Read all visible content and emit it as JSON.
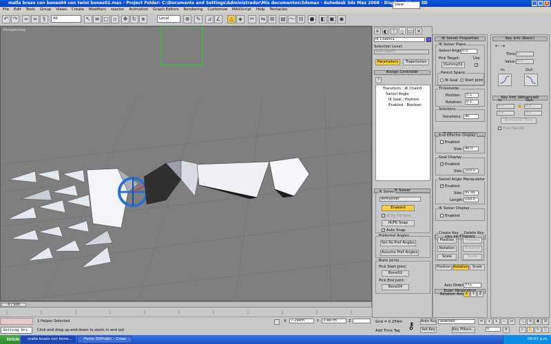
{
  "window": {
    "title": "malla brazo con bones04 con twist bones02.max   - Project Folder: C:\\Documents and Settings\\Administrador\\Mis documentos\\3dsmax   - Autodesk 3ds Max 2008   - Display : Direct 3D"
  },
  "menu": [
    "File",
    "Edit",
    "Tools",
    "Group",
    "Views",
    "Create",
    "Modifiers",
    "reactor",
    "Animation",
    "Graph Editors",
    "Rendering",
    "Customize",
    "MAXScript",
    "Help",
    "Tentacles"
  ],
  "toolbar": {
    "filter_value": "All",
    "coord_value": "Local",
    "view_value": "View"
  },
  "viewport": {
    "label": "Perspective",
    "frame_counter": "0 / 100"
  },
  "command_panel": {
    "object_name": "IK Chain01",
    "selection_level_label": "Selection Level:",
    "sub_object_value": "Sub-Object",
    "parameters_tab": "Parameters",
    "trajectories_tab": "Trajectories",
    "assign_controller_title": "Assign Controller",
    "controller_tree": [
      "Transform : IK Chain0",
      "Swivel Angle",
      "IK Goal : Position",
      "Enabled : Boolean"
    ],
    "ik_solver_title": "IK Solver",
    "solver_value": "IKHISolver",
    "enabled_button": "Enabled",
    "ik_for_fk_pose": "IK for FK Pose",
    "ikfk_snap_button": "IK/FK Snap",
    "auto_snap_label": "Auto Snap",
    "preferred_angles_title": "Preferred Angles",
    "set_pref_angles_button": "Set As Pref Angles",
    "assume_pref_angles_button": "Assume Pref Angles",
    "bone_joints_title": "Bone Joints",
    "pick_start_joint_label": "Pick Start Joint:",
    "start_joint_button": "Bone02",
    "pick_end_joint_label": "Pick End Joint:",
    "end_joint_button": "Bone04"
  },
  "ik_solver_props": {
    "title": "IK Solver Properties",
    "ik_solver_plane_title": "IK Solver Plane",
    "swivel_angle_label": "Swivel Angle:",
    "swivel_angle_value": "0.0",
    "pick_target_label": "Pick Target:",
    "use_label": "Use",
    "pick_target_button": "Dummy01",
    "parent_space_title": "Parent Space:",
    "ik_goal_label": "IK Goal",
    "start_joint_label": "Start Joint",
    "thresholds_title": "Thresholds:",
    "position_label": "Position:",
    "position_value": "0.1",
    "rotation_label": "Rotation:",
    "rotation_value": "0.1",
    "solutions_title": "Solutions:",
    "iterations_label": "Iterations:",
    "iterations_value": "40"
  },
  "ik_display": {
    "title": "IK Display Options",
    "end_effector_title": "End Effector Display",
    "enabled_label": "Enabled",
    "size_label": "Size:",
    "ee_size_value": "40.0",
    "goal_display_title": "Goal Display",
    "goal_size_value": "100.0",
    "swivel_manip_title": "Swivel Angle Manipulator",
    "swivel_size_value": "85.99",
    "length_label": "Length:",
    "length_value": "100.0",
    "solver_display_title": "IK Solver Display"
  },
  "prs": {
    "title": "PRS Parameters",
    "create_key_title": "Create Key",
    "delete_key_title": "Delete Key",
    "position_button": "Position",
    "rotation_button": "Rotation",
    "scale_button": "Scale",
    "euler_title": "Euler Parameters",
    "axis_order_label": "Axis Order:",
    "axis_order_value": "XYZ",
    "rotation_axis_label": "Rotation Axis:",
    "axis_x": "X",
    "axis_y": "Y",
    "axis_z": "Z"
  },
  "key_info": {
    "basic_title": "Key Info (Basic)",
    "time_label": "Time:",
    "time_value": "0",
    "value_label": "Value:",
    "value_value": "0.0",
    "in_label": "In:",
    "out_label": "Out:",
    "advanced_title": "Key Info (Advanced)",
    "adv_in_value": "0.0",
    "adv_out_value": "0.0",
    "adv_in2_value": "0.0",
    "adv_out2_value": "0.0",
    "normalize_time_button": "Normalize Time",
    "free_handle_label": "Free Handle"
  },
  "statusbar": {
    "setting_label": "Setting Ori",
    "helper_status": "1 Helper Selected",
    "prompt": "Click and drag up-and-down to zoom in and out",
    "x_value": "7.296m",
    "y_value": "3.887m",
    "z_value": "",
    "grid_value": "Grid = 0.254m",
    "add_time_tag": "Add Time Tag",
    "auto_key_button": "Auto Key",
    "set_key_button": "Set Key",
    "selected_value": "Selected",
    "key_filters_button": "Key Filters...",
    "frame_value": "0"
  },
  "taskbar": {
    "start_label": "Inicio",
    "tasks": [
      "malla brazo con bone...",
      "Foros 3DPoder. - Crear ..."
    ],
    "clock": "06:07 a.m."
  }
}
